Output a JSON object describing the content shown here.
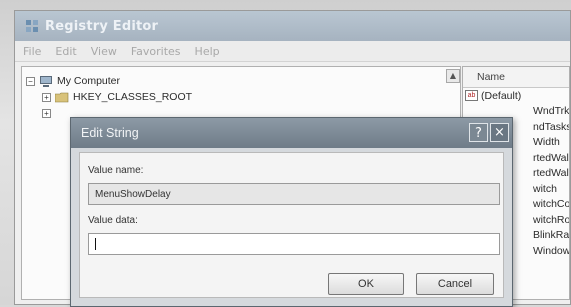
{
  "registry_window": {
    "title": "Registry Editor",
    "menu": [
      "File",
      "Edit",
      "View",
      "Favorites",
      "Help"
    ],
    "tree": [
      {
        "label": "My Computer"
      },
      {
        "label": "HKEY_CLASSES_ROOT"
      }
    ],
    "list": {
      "header_name": "Name",
      "items": [
        "(Default)",
        "WndTrkTe",
        "ndTasks",
        "Width",
        "rtedWallp",
        "rtedWallp",
        "witch",
        "witchColum",
        "witchRows",
        "BlinkRate",
        "Windows"
      ]
    }
  },
  "dialog": {
    "title": "Edit String",
    "help_glyph": "?",
    "close_glyph": "×",
    "value_name_label": "Value name:",
    "value_name": "MenuShowDelay",
    "value_data_label": "Value data:",
    "value_data": "",
    "ok_label": "OK",
    "cancel_label": "Cancel"
  },
  "icons": {
    "folder": "folder-icon",
    "computer": "computer-icon",
    "string_value": "ab-icon"
  },
  "colors": {
    "title_bar": "#a6b3c0",
    "dialog_title_bar": "#6f7c88"
  }
}
